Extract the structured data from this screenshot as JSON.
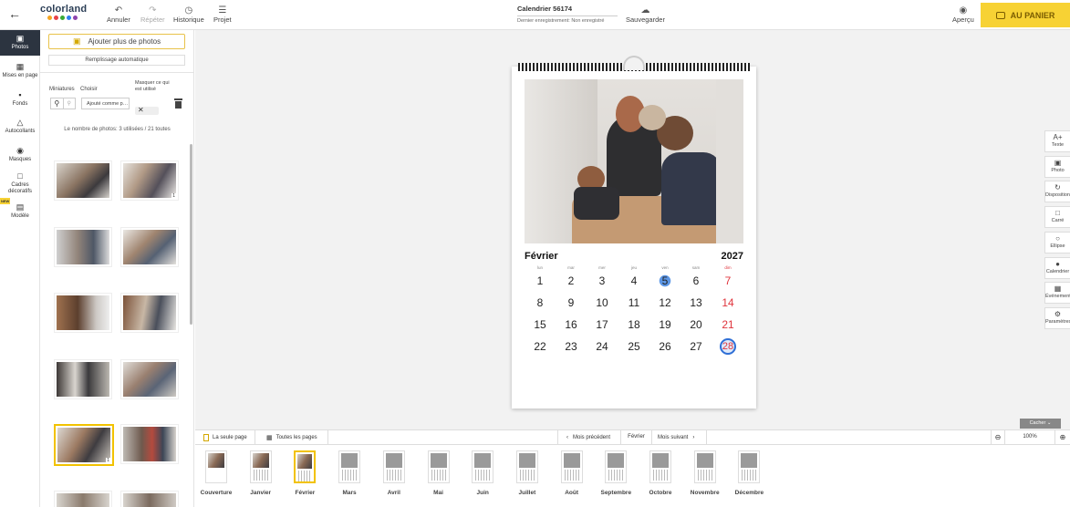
{
  "topbar": {
    "brand": "colorland",
    "undo": "Annuler",
    "redo": "Répéter",
    "history": "Historique",
    "project": "Projet",
    "doc_title": "Calendrier 56174",
    "last_saved_label": "Dernier enregistrement:",
    "last_saved_value": "Non enregistré",
    "save": "Sauvegarder",
    "preview": "Aperçu",
    "cart": "AU PANIER"
  },
  "rail": [
    {
      "label": "Photos",
      "icon": "photos-icon"
    },
    {
      "label": "Mises en page",
      "icon": "layouts-icon"
    },
    {
      "label": "Fonds",
      "icon": "backgrounds-icon"
    },
    {
      "label": "Autocollants",
      "icon": "stickers-icon"
    },
    {
      "label": "Masques",
      "icon": "masks-icon"
    },
    {
      "label": "Cadres décoratifs",
      "icon": "frames-icon",
      "badge": "NEW"
    },
    {
      "label": "Modèle",
      "icon": "template-icon"
    }
  ],
  "panel": {
    "add_photos": "Ajouter plus de photos",
    "autofill": "Remplissage automatique",
    "thumbs_label": "Miniatures",
    "choose_label": "Choisir",
    "choose_value": "Ajouté comme p…",
    "hide_used_label": "Masquer ce qui est utilisé",
    "photo_count": "Le nombre de photos: 3 utilisées / 21 toutes"
  },
  "calendar": {
    "month": "Février",
    "year": "2027",
    "day_names": [
      "lun",
      "mar",
      "mer",
      "jeu",
      "ven",
      "sam",
      "dim"
    ],
    "weeks": [
      [
        "1",
        "2",
        "3",
        "4",
        "5",
        "6",
        "7"
      ],
      [
        "8",
        "9",
        "10",
        "11",
        "12",
        "13",
        "14"
      ],
      [
        "15",
        "16",
        "17",
        "18",
        "19",
        "20",
        "21"
      ],
      [
        "22",
        "23",
        "24",
        "25",
        "26",
        "27",
        "28"
      ]
    ]
  },
  "right_tools": [
    {
      "label": "Texte",
      "icon": "text-icon"
    },
    {
      "label": "Photo",
      "icon": "photo-add-icon"
    },
    {
      "label": "Disposition",
      "icon": "arrange-icon"
    },
    {
      "label": "Carré",
      "icon": "square-icon"
    },
    {
      "label": "Ellipse",
      "icon": "ellipse-icon"
    },
    {
      "label": "Calendrier",
      "icon": "calendar-color-icon"
    },
    {
      "label": "Événement",
      "icon": "event-icon"
    },
    {
      "label": "Paramètres",
      "icon": "settings-icon"
    }
  ],
  "bottombar": {
    "single_page": "La seule page",
    "all_pages": "Toutes les pages",
    "prev_month": "Mois précédent",
    "current_month": "Février",
    "next_month": "Mois suivant",
    "zoom": "100%",
    "hide": "Cacher"
  },
  "months": [
    "Couverture",
    "Janvier",
    "Février",
    "Mars",
    "Avril",
    "Mai",
    "Juin",
    "Juillet",
    "Août",
    "Septembre",
    "Octobre",
    "Novembre",
    "Décembre"
  ],
  "colors": {
    "accent": "#f7d234",
    "brand_dots": [
      "#f5a623",
      "#e8424a",
      "#3aaa35",
      "#2f80ed",
      "#8e44ad"
    ],
    "sunday": "#e0343c",
    "highlight": "#2f6fd6"
  }
}
